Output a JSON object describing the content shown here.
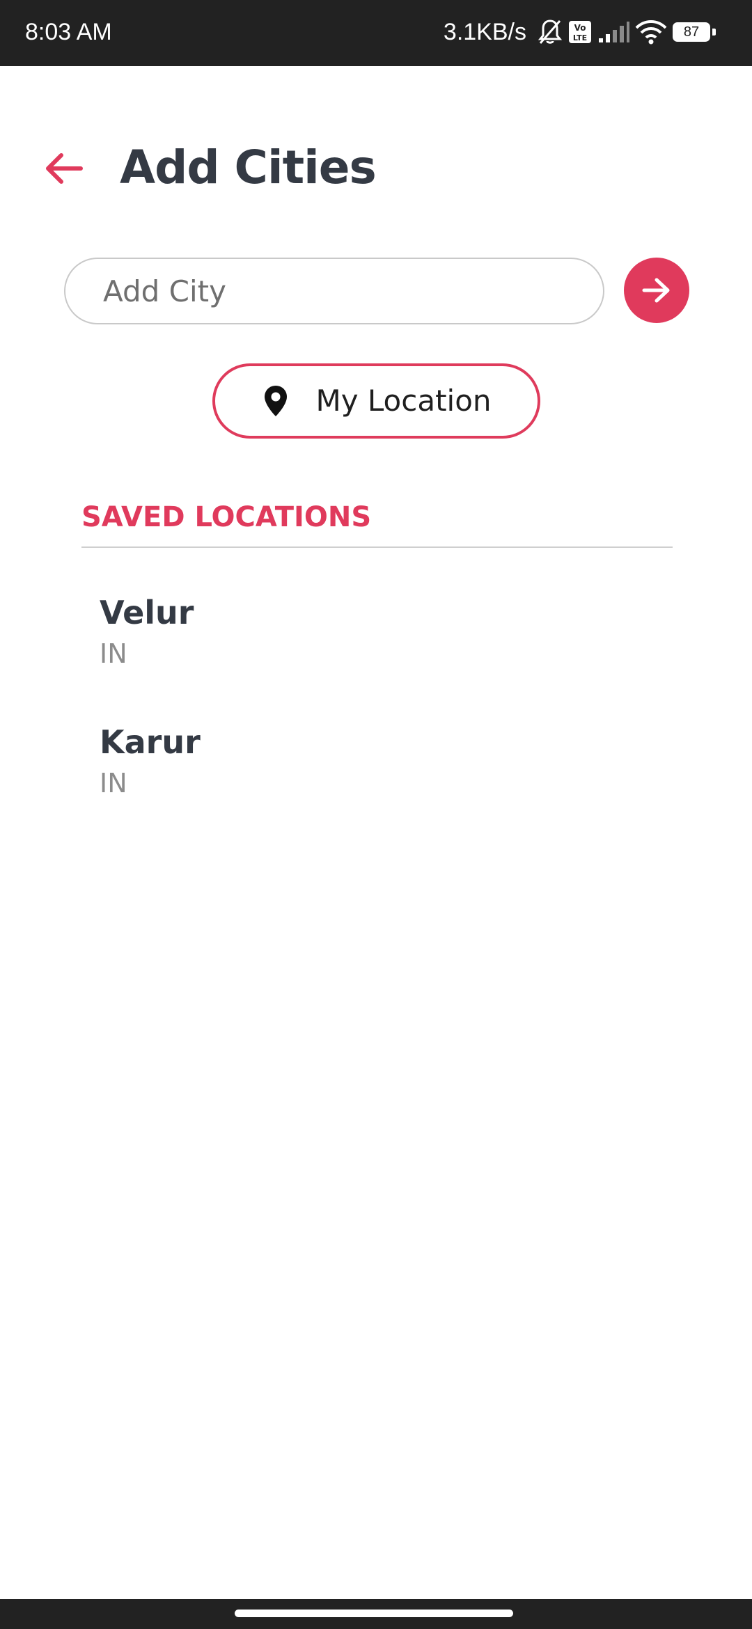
{
  "status_bar": {
    "time": "8:03 AM",
    "network_speed": "3.1KB/s",
    "battery_level": "87",
    "icons": [
      "bell-muted-icon",
      "volte-icon",
      "signal-icon",
      "wifi-icon",
      "battery-icon"
    ]
  },
  "header": {
    "title": "Add Cities",
    "back_icon": "arrow-left-icon"
  },
  "search": {
    "placeholder": "Add City",
    "value": "",
    "submit_icon": "arrow-right-icon"
  },
  "location_button": {
    "label": "My Location",
    "icon": "map-pin-icon"
  },
  "saved_locations": {
    "heading": "SAVED LOCATIONS",
    "items": [
      {
        "city": "Velur",
        "country": "IN"
      },
      {
        "city": "Karur",
        "country": "IN"
      }
    ]
  },
  "colors": {
    "accent": "#e03a5c",
    "text_primary": "#343a44",
    "text_secondary": "#8c8c8c",
    "system_bar": "#222222"
  }
}
